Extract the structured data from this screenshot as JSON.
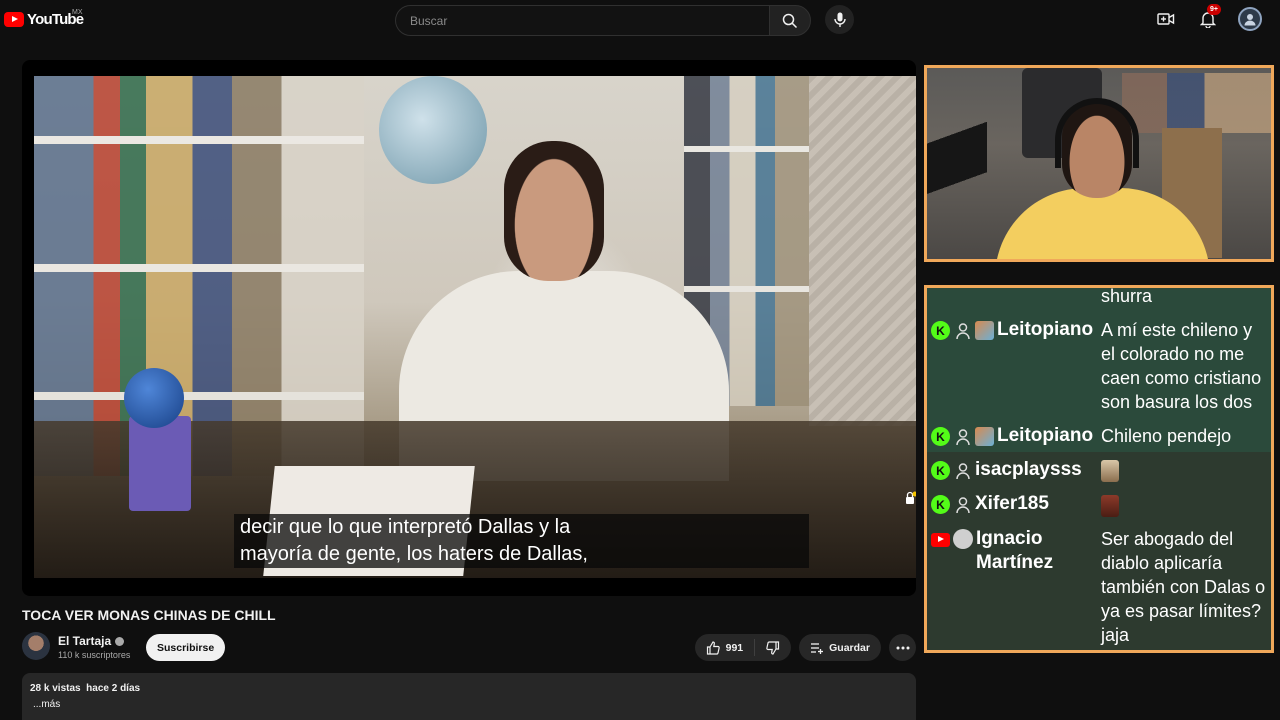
{
  "header": {
    "logo_text": "YouTube",
    "country_code": "MX",
    "search_placeholder": "Buscar",
    "notifications_count": "9+"
  },
  "player": {
    "captions": [
      "decir que lo que interpretó Dallas y la",
      "mayoría de gente, los haters de Dallas,"
    ]
  },
  "chat": {
    "messages": [
      {
        "platform": "kick",
        "user": "",
        "text": "aplastado como el shurra",
        "highlight": true
      },
      {
        "platform": "kick",
        "user": "Leitopiano",
        "text": "A mí este chileno y el colorado no me caen como cristiano son basura los dos",
        "highlight": true
      },
      {
        "platform": "kick",
        "user": "Leitopiano",
        "text": "Chileno pendejo",
        "highlight": true
      },
      {
        "platform": "kick",
        "user": "isacplaysss",
        "text": "",
        "highlight": false
      },
      {
        "platform": "kick",
        "user": "Xifer185",
        "text": "",
        "highlight": false
      },
      {
        "platform": "youtube",
        "user": "Ignacio Martínez",
        "text": "Ser abogado del diablo aplicaría también con Dalas o ya es pasar límites? jaja",
        "highlight": false
      }
    ]
  },
  "video": {
    "title": "TOCA VER MONAS CHINAS DE CHILL",
    "channel_name": "El Tartaja",
    "subscribers": "110 k suscriptores",
    "subscribe_label": "Suscribirse",
    "likes": "991",
    "save_label": "Guardar",
    "views_date": "28 k vistas  hace 2 días",
    "more_label": "...más"
  },
  "colors": {
    "accent_border": "#f0a85a",
    "kick_green": "#53fc18",
    "youtube_red": "#ff0000",
    "chat_bg": "#2e3b30"
  }
}
